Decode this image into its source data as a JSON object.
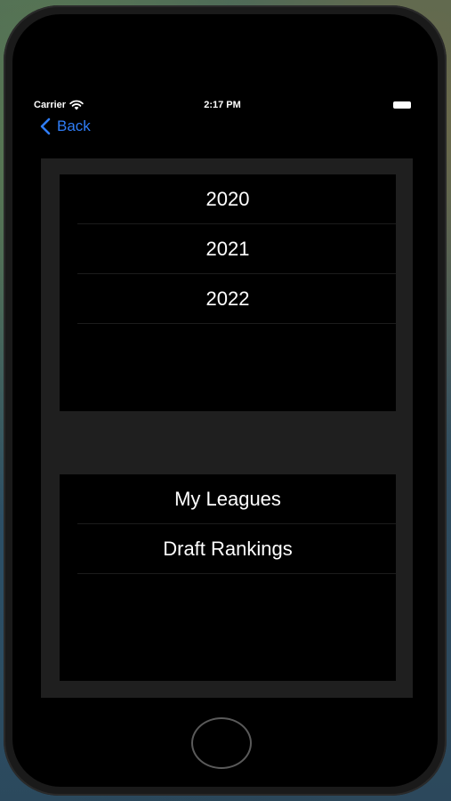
{
  "status_bar": {
    "carrier": "Carrier",
    "time": "2:17 PM"
  },
  "nav": {
    "back_label": "Back",
    "accent_color": "#2f7df6"
  },
  "years": [
    "2020",
    "2021",
    "2022"
  ],
  "menu": [
    "My Leagues",
    "Draft Rankings"
  ],
  "icons": [
    "wifi-icon",
    "battery-icon",
    "chevron-left-icon",
    "home-button"
  ]
}
